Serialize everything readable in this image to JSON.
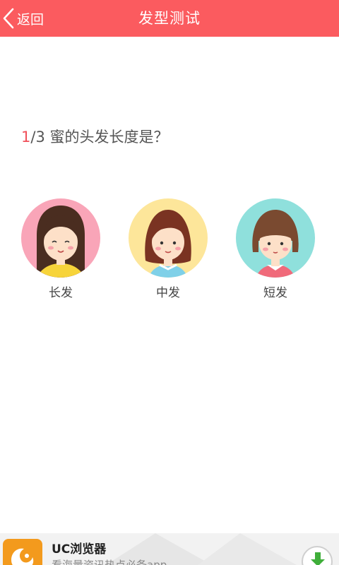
{
  "header": {
    "back_label": "返回",
    "title": "发型测试"
  },
  "question": {
    "current": "1",
    "total_text": "/3",
    "text": "蜜的头发长度是？"
  },
  "options": [
    {
      "label": "长发"
    },
    {
      "label": "中发"
    },
    {
      "label": "短发"
    }
  ],
  "ad": {
    "title": "UC浏览器",
    "subtitle": "看海量资讯热点必备app"
  },
  "colors": {
    "header_bg": "#fb5b5f",
    "accent": "#f0505a"
  }
}
